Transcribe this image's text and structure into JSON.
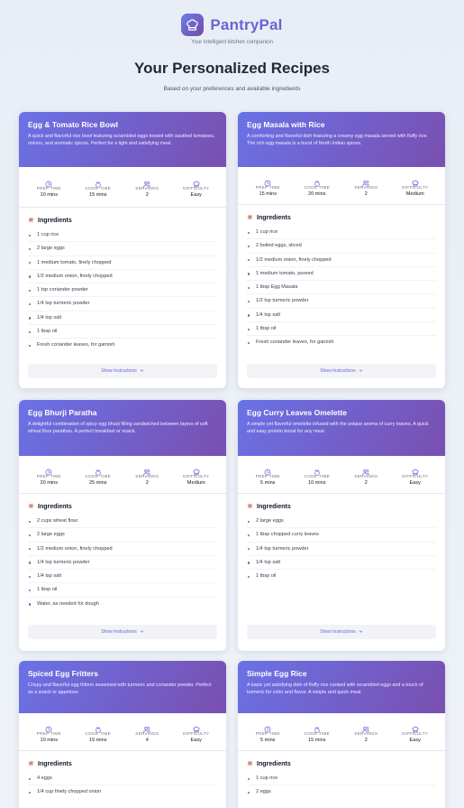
{
  "brand": {
    "name": "PantryPal",
    "tagline": "Your intelligent kitchen companion"
  },
  "page": {
    "title": "Your Personalized Recipes",
    "subtitle": "Based on your preferences and available ingredients"
  },
  "labels": {
    "prep": "PREP TIME",
    "cook": "COOK TIME",
    "servings": "SERVINGS",
    "difficulty": "DIFFICULTY",
    "ingredients": "Ingredients",
    "show_instructions": "Show Instructions"
  },
  "colors": {
    "accent": "#6b63d6",
    "header_start": "#6a72e6",
    "header_end": "#7a4fb0"
  },
  "recipes": [
    {
      "title": "Egg & Tomato Rice Bowl",
      "description": "A quick and flavorful rice bowl featuring scrambled eggs tossed with sautéed tomatoes, onions, and aromatic spices. Perfect for a light and satisfying meal.",
      "prep": "10 mins",
      "cook": "15 mins",
      "servings": "2",
      "difficulty": "Easy",
      "ingredients": [
        "1 cup rice",
        "2 large eggs",
        "1 medium tomato, finely chopped",
        "1/2 medium onion, finely chopped",
        "1 tsp coriander powder",
        "1/4 tsp turmeric powder",
        "1/4 tsp salt",
        "1 tbsp oil",
        "Fresh coriander leaves, for garnish"
      ]
    },
    {
      "title": "Egg Masala with Rice",
      "description": "A comforting and flavorful dish featuring a creamy egg masala served with fluffy rice. The rich egg masala is a burst of North Indian spices.",
      "prep": "15 mins",
      "cook": "20 mins",
      "servings": "2",
      "difficulty": "Medium",
      "ingredients": [
        "1 cup rice",
        "2 boiled eggs, sliced",
        "1/2 medium onion, finely chopped",
        "1 medium tomato, pureed",
        "1 tbsp Egg Masala",
        "1/2 tsp turmeric powder",
        "1/4 tsp salt",
        "1 tbsp oil",
        "Fresh coriander leaves, for garnish"
      ]
    },
    {
      "title": "Egg Bhurji Paratha",
      "description": "A delightful combination of spicy egg bhurji filling sandwiched between layers of soft wheat flour parathas. A perfect breakfast or snack.",
      "prep": "20 mins",
      "cook": "25 mins",
      "servings": "2",
      "difficulty": "Medium",
      "ingredients": [
        "2 cups wheat flour",
        "2 large eggs",
        "1/2 medium onion, finely chopped",
        "1/4 tsp turmeric powder",
        "1/4 tsp salt",
        "1 tbsp oil",
        "Water, as needed for dough"
      ]
    },
    {
      "title": "Egg Curry Leaves Omelette",
      "description": "A simple yet flavorful omelette infused with the unique aroma of curry leaves. A quick and easy protein boost for any meal.",
      "prep": "5 mins",
      "cook": "10 mins",
      "servings": "2",
      "difficulty": "Easy",
      "ingredients": [
        "2 large eggs",
        "1 tbsp chopped curry leaves",
        "1/4 tsp turmeric powder",
        "1/4 tsp salt",
        "1 tbsp oil"
      ]
    },
    {
      "title": "Spiced Egg Fritters",
      "description": "Crispy and flavorful egg fritters seasoned with turmeric and coriander powder. Perfect as a snack or appetizer.",
      "prep": "10 mins",
      "cook": "15 mins",
      "servings": "4",
      "difficulty": "Easy",
      "ingredients": [
        "4 eggs",
        "1/4 cup finely chopped onion"
      ]
    },
    {
      "title": "Simple Egg Rice",
      "description": "A basic yet satisfying dish of fluffy rice cooked with scrambled eggs and a touch of turmeric for color and flavor. A simple and quick meal.",
      "prep": "5 mins",
      "cook": "15 mins",
      "servings": "2",
      "difficulty": "Easy",
      "ingredients": [
        "1 cup rice",
        "2 eggs"
      ]
    }
  ]
}
